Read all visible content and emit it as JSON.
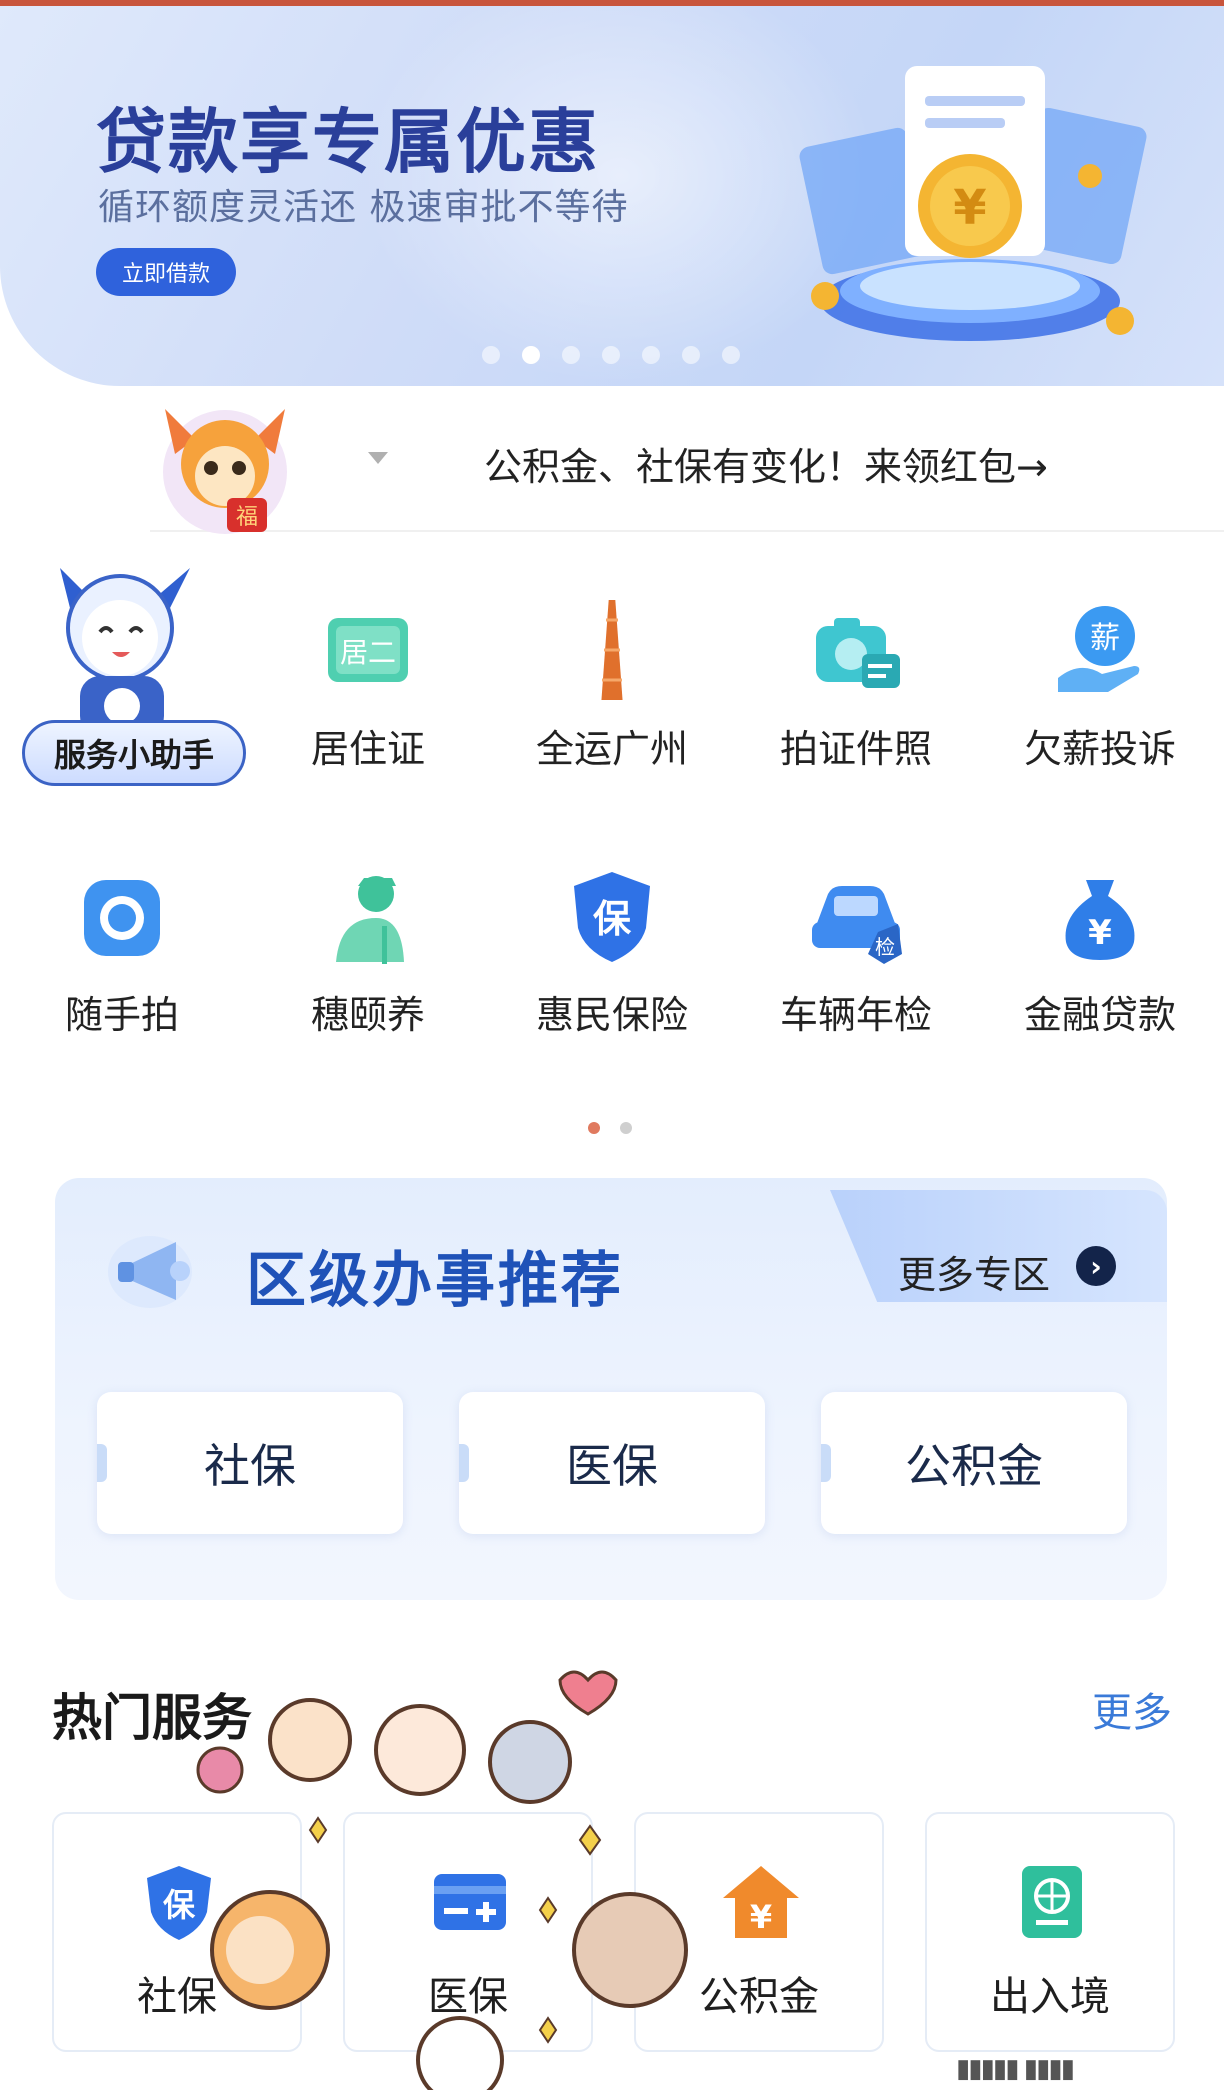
{
  "banner": {
    "title": "贷款享专属优惠",
    "subtitle": "循环额度灵活还 极速审批不等待",
    "button_label": "立即借款",
    "carousel_total": 7,
    "carousel_active": 2
  },
  "notice": {
    "text": "公积金、社保有变化！来领红包→"
  },
  "assistant": {
    "label": "服务小助手"
  },
  "services_row1": [
    {
      "label": "居住证",
      "icon": "id-card-icon"
    },
    {
      "label": "全运广州",
      "icon": "canton-tower-icon"
    },
    {
      "label": "拍证件照",
      "icon": "camera-id-icon"
    },
    {
      "label": "欠薪投诉",
      "icon": "salary-hand-icon"
    }
  ],
  "services_row2": [
    {
      "label": "随手拍",
      "icon": "camera-icon"
    },
    {
      "label": "穗颐养",
      "icon": "elder-icon"
    },
    {
      "label": "惠民保险",
      "icon": "insurance-shield-icon"
    },
    {
      "label": "车辆年检",
      "icon": "car-inspection-icon"
    },
    {
      "label": "金融贷款",
      "icon": "money-bag-icon"
    }
  ],
  "district": {
    "title": "区级办事推荐",
    "more_label": "更多专区",
    "cards": [
      "社保",
      "医保",
      "公积金"
    ]
  },
  "hot": {
    "title": "热门服务",
    "more_label": "更多",
    "items": [
      {
        "label": "社保",
        "icon": "shield-icon"
      },
      {
        "label": "医保",
        "icon": "card-plus-icon"
      },
      {
        "label": "公积金",
        "icon": "house-yuan-icon"
      },
      {
        "label": "出入境",
        "icon": "passport-icon"
      }
    ]
  },
  "colors": {
    "primary": "#2f62dc",
    "district_title": "#1f52b8",
    "more_link": "#3a7ad8",
    "accent_dot": "#e07a5f"
  }
}
